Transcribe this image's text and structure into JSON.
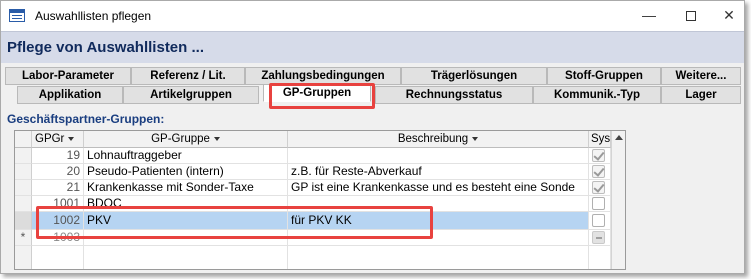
{
  "window": {
    "title": "Auswahllisten pflegen"
  },
  "form": {
    "title": "Pflege von Auswahllisten ..."
  },
  "tabs_row1": [
    {
      "label": "Labor-Parameter"
    },
    {
      "label": "Referenz / Lit."
    },
    {
      "label": "Zahlungsbedingungen"
    },
    {
      "label": "Trägerlösungen"
    },
    {
      "label": "Stoff-Gruppen"
    },
    {
      "label": "Weitere..."
    }
  ],
  "tabs_row2": [
    {
      "label": "Applikation"
    },
    {
      "label": "Artikelgruppen"
    },
    {
      "label": "GP-Gruppen",
      "active": true
    },
    {
      "label": "Rechnungsstatus"
    },
    {
      "label": "Kommunik.-Typ"
    },
    {
      "label": "Lager"
    }
  ],
  "section": {
    "label": "Geschäftspartner-Gruppen:"
  },
  "grid": {
    "columns": [
      "GPGr",
      "GP-Gruppe",
      "Beschreibung",
      "SysD"
    ],
    "rows": [
      {
        "id": "19",
        "gruppe": "Lohnauftraggeber",
        "beschreibung": "",
        "sys": "checked"
      },
      {
        "id": "20",
        "gruppe": "Pseudo-Patienten (intern)",
        "beschreibung": "z.B. für Reste-Abverkauf",
        "sys": "checked"
      },
      {
        "id": "21",
        "gruppe": "Krankenkasse mit Sonder-Taxe",
        "beschreibung": "GP ist eine Krankenkasse und es besteht eine Sonde",
        "sys": "checked"
      },
      {
        "id": "1001",
        "gruppe": "BDOC",
        "beschreibung": "",
        "sys": "unchecked"
      },
      {
        "id": "1002",
        "gruppe": "PKV",
        "beschreibung": "für PKV KK",
        "sys": "unchecked",
        "selected": true
      },
      {
        "id": "1003",
        "gruppe": "",
        "beschreibung": "",
        "sys": "newrow",
        "new_marker": "*"
      }
    ]
  },
  "colors": {
    "highlight": "#e8423f",
    "selected_row": "#b6d4f2",
    "header_band": "#d6dbe9"
  }
}
